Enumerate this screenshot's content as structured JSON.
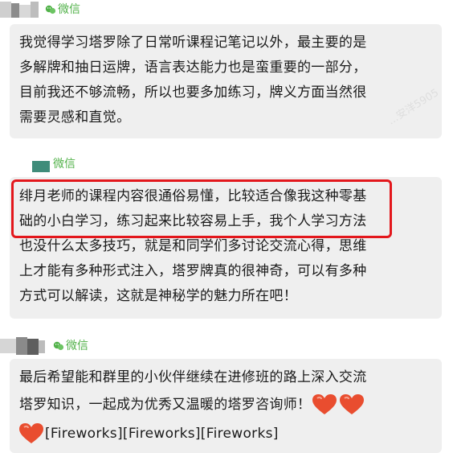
{
  "source_label": "微信",
  "watermark_text": "...安洋5905",
  "accent_color": "#52b24a",
  "highlight_color": "#e3171c",
  "messages": [
    {
      "lines": [
        "我觉得学习塔罗除了日常听课程记笔记以外，最主要的是",
        "多解牌和抽日运牌，语言表达能力也是蛮重要的一部分，",
        "目前我还不够流畅，所以也要多加练习，牌义方面当然很",
        "需要灵感和直觉。"
      ]
    },
    {
      "lines": [
        "绯月老师的课程内容很通俗易懂，比较适合像我这种零基",
        "础的小白学习，练习起来比较容易上手，我个人学习方法",
        "也没什么太多技巧，就是和同学们多讨论交流心得，思维",
        "上才能有多种形式注入，塔罗牌真的很神奇，可以有多种",
        "方式可以解读，这就是神秘学的魅力所在吧！"
      ]
    },
    {
      "lines": [
        "最后希望能和群里的小伙伴继续在进修班的路上深入交流",
        "塔罗知识，一起成为优秀又温暖的塔罗咨询师！"
      ],
      "fireworks_text": "[Fireworks][Fireworks][Fireworks]",
      "emoji": [
        "heart",
        "heart",
        "heart"
      ]
    }
  ]
}
